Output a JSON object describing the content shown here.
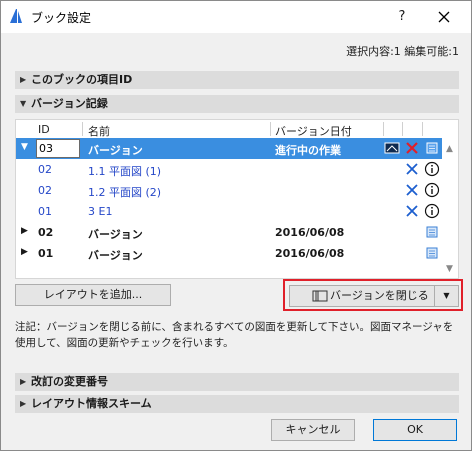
{
  "window": {
    "title": "ブック設定",
    "help_label": "?",
    "close_label": "×"
  },
  "selection_info": "選択内容:1  編集可能:1",
  "sections": {
    "book_item_id": "このブックの項目ID",
    "version_history": "バージョン記録",
    "revision_change_number": "改訂の変更番号",
    "layout_info_scheme": "レイアウト情報スキーム"
  },
  "table": {
    "headers": {
      "id": "ID",
      "name": "名前",
      "date": "バージョン日付"
    },
    "rows": [
      {
        "id": "03",
        "name": "バージョン",
        "date": "進行中の作業",
        "kind": "current"
      },
      {
        "id": "02",
        "name": "1.1 平面図 (1)",
        "kind": "sub"
      },
      {
        "id": "02",
        "name": "1.2 平面図 (2)",
        "kind": "sub"
      },
      {
        "id": "01",
        "name": "3 E1",
        "kind": "sub"
      },
      {
        "id": "02",
        "name": "バージョン",
        "date": "2016/06/08",
        "kind": "version"
      },
      {
        "id": "01",
        "name": "バージョン",
        "date": "2016/06/08",
        "kind": "version"
      }
    ]
  },
  "buttons": {
    "add_layout": "レイアウトを追加...",
    "close_version": "バージョンを閉じる",
    "cancel": "キャンセル",
    "ok": "OK"
  },
  "note": "注記：バージョンを閉じる前に、含まれるすべての図面を更新して下さい。図面マネージャを使用して、図面の更新やチェックを行います。",
  "colors": {
    "selection": "#3a8ee0",
    "sub_text": "#2547c8",
    "highlight_border": "#e0202a",
    "delete_red": "#e0202a",
    "remove_blue": "#1d5fcf"
  }
}
